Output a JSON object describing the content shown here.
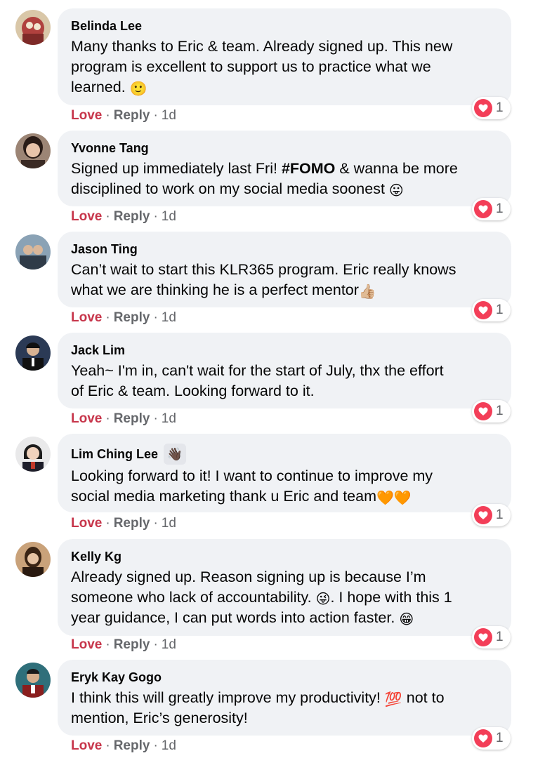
{
  "comments": [
    {
      "author": "Belinda Lee",
      "text_lines": [
        "Many thanks to Eric & team. Already signed up. This new",
        "program is excellent to support us to practice what we",
        "learned. "
      ],
      "emoji_end": "🙂",
      "love": "Love",
      "reply": "Reply",
      "time": "1d",
      "reaction_count": "1",
      "avatar_color": "#b0413e"
    },
    {
      "author": "Yvonne Tang",
      "text_pre": "Signed up immediately last Fri! ",
      "hashtag": "#FOMO",
      "text_post_line1": " & wanna be more",
      "text_line2": "disciplined to work on my social media soonest ",
      "emoji_end": "😛",
      "love": "Love",
      "reply": "Reply",
      "time": "1d",
      "reaction_count": "1",
      "avatar_color": "#3a2a24"
    },
    {
      "author": "Jason Ting",
      "text_lines": [
        "Can’t wait to start this KLR365 program. Eric really knows",
        "what we are thinking he is a perfect mentor"
      ],
      "emoji_end": "👍🏼",
      "love": "Love",
      "reply": "Reply",
      "time": "1d",
      "reaction_count": "1",
      "avatar_color": "#5b6b7d"
    },
    {
      "author": "Jack Lim",
      "text_lines": [
        "Yeah~ I'm in, can't wait for the start of July, thx the effort",
        "of Eric & team. Looking forward to it."
      ],
      "love": "Love",
      "reply": "Reply",
      "time": "1d",
      "reaction_count": "1",
      "avatar_color": "#1d1f27"
    },
    {
      "author": "Lim Ching Lee",
      "author_badge": "👋🏿",
      "text_lines": [
        "Looking forward to it! I want to continue to improve my",
        "social media marketing thank u Eric and team"
      ],
      "emoji_end": "🧡🧡",
      "love": "Love",
      "reply": "Reply",
      "time": "1d",
      "reaction_count": "1",
      "avatar_color": "#c0392b"
    },
    {
      "author": "Kelly Kg",
      "text_line1": "Already signed up. Reason signing up is because I’m",
      "text_line2_pre": "someone who lack of accountability. ",
      "emoji_mid": "😜",
      "text_line2_post": ". I hope with this 1",
      "text_line3": "year guidance, I can put words into action faster. ",
      "emoji_end": "😁",
      "love": "Love",
      "reply": "Reply",
      "time": "1d",
      "reaction_count": "1",
      "avatar_color": "#6e4b2a"
    },
    {
      "author": "Eryk Kay Gogo",
      "text_line1_pre": "I think this will greatly improve my productivity! ",
      "emoji_mid": "💯",
      "text_line1_post": " not to",
      "text_line2": "mention, Eric’s generosity!",
      "love": "Love",
      "reply": "Reply",
      "time": "1d",
      "reaction_count": "1",
      "avatar_color": "#8a1e1e"
    }
  ],
  "colors": {
    "love": "#c7364b",
    "heart": "#f33e58",
    "bubble": "#f0f2f5",
    "muted": "#65676b"
  },
  "icons": {
    "reaction": "heart-icon"
  }
}
